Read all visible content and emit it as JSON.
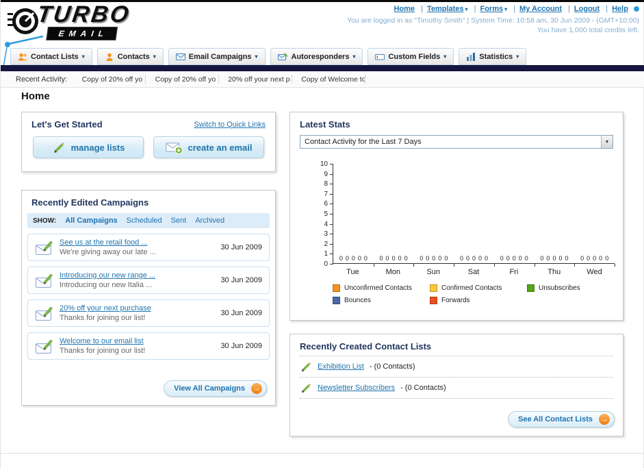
{
  "header": {
    "logo": {
      "line1": "TURBO",
      "line2": "EMAIL"
    },
    "nav": [
      {
        "label": "Home"
      },
      {
        "label": "Templates"
      },
      {
        "label": "Forms"
      },
      {
        "label": "My Account"
      },
      {
        "label": "Logout"
      },
      {
        "label": "Help"
      }
    ],
    "login_info": "You are logged in as \"Timothy Smith\" | System Time: 10:58 am, 30 Jun 2009 - (GMT+10:00)",
    "credits": "You have 1,000 total credits left."
  },
  "nav_tabs": [
    {
      "label": "Contact Lists",
      "icon": "contact-lists-icon"
    },
    {
      "label": "Contacts",
      "icon": "contact-icon"
    },
    {
      "label": "Email Campaigns",
      "icon": "email-campaigns-icon"
    },
    {
      "label": "Autoresponders",
      "icon": "autoresponders-icon"
    },
    {
      "label": "Custom Fields",
      "icon": "custom-fields-icon"
    },
    {
      "label": "Statistics",
      "icon": "statistics-icon"
    }
  ],
  "recent_activity": {
    "label": "Recent Activity:",
    "items": [
      "Copy of 20% off yo",
      "Copy of 20% off yo",
      "20% off your next p",
      "Copy of Welcome to"
    ]
  },
  "page": {
    "title": "Home"
  },
  "get_started": {
    "title": "Let's Get Started",
    "switch_link": "Switch to Quick Links",
    "manage_lists": "manage lists",
    "create_email": "create an email"
  },
  "campaigns": {
    "title": "Recently Edited Campaigns",
    "show_label": "SHOW:",
    "filters": [
      "All Campaigns",
      "Scheduled",
      "Sent",
      "Archived"
    ],
    "selected_filter": "All Campaigns",
    "items": [
      {
        "title": "See us at the retail food ...",
        "subtitle": "We're giving away our late ...",
        "date": "30 Jun 2009"
      },
      {
        "title": "Introducing our new range ...",
        "subtitle": "Introducing our new Italia ...",
        "date": "30 Jun 2009"
      },
      {
        "title": "20% off your next purchase",
        "subtitle": "Thanks for joining our list!",
        "date": "30 Jun 2009"
      },
      {
        "title": "Welcome to our email list",
        "subtitle": "Thanks for joining our list!",
        "date": "30 Jun 2009"
      }
    ],
    "view_all": "View All Campaigns"
  },
  "stats": {
    "title": "Latest Stats",
    "period_select": "Contact Activity for the Last 7 Days"
  },
  "chart_data": {
    "type": "bar",
    "title": "Contact Activity for the Last 7 Days",
    "categories": [
      "Tue",
      "Mon",
      "Sun",
      "Sat",
      "Fri",
      "Thu",
      "Wed"
    ],
    "series": [
      {
        "name": "Unconfirmed Contacts",
        "color": "#f6921e",
        "values": [
          0,
          0,
          0,
          0,
          0,
          0,
          0
        ]
      },
      {
        "name": "Confirmed Contacts",
        "color": "#fdc636",
        "values": [
          0,
          0,
          0,
          0,
          0,
          0,
          0
        ]
      },
      {
        "name": "Unsubscribes",
        "color": "#55a515",
        "values": [
          0,
          0,
          0,
          0,
          0,
          0,
          0
        ]
      },
      {
        "name": "Bounces",
        "color": "#4a69a5",
        "values": [
          0,
          0,
          0,
          0,
          0,
          0,
          0
        ]
      },
      {
        "name": "Forwards",
        "color": "#e8501f",
        "values": [
          0,
          0,
          0,
          0,
          0,
          0,
          0
        ]
      }
    ],
    "ylim": [
      0,
      10
    ],
    "grid": false,
    "legend_position": "bottom",
    "xlabel": "",
    "ylabel": ""
  },
  "contact_lists": {
    "title": "Recently Created Contact Lists",
    "items": [
      {
        "name": "Exhibition List",
        "count": "- (0 Contacts)"
      },
      {
        "name": "Newsletter Subscribers",
        "count": "- (0 Contacts)"
      }
    ],
    "see_all": "See All Contact Lists"
  },
  "colors": {
    "accent_blue": "#1e73b0",
    "dark_bar": "#15153f",
    "accent_orange": "#f6921e"
  }
}
